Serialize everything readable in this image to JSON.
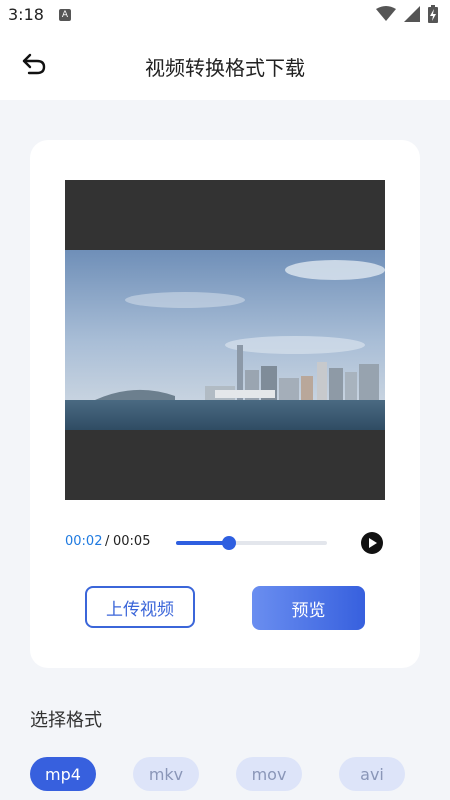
{
  "status_bar": {
    "time": "3:18",
    "notification_icon": "A",
    "icons": [
      "wifi-icon",
      "cellular-signal-icon",
      "battery-charging-icon"
    ]
  },
  "header": {
    "back_icon": "back-arrow-icon",
    "title": "视频转换格式下载"
  },
  "player": {
    "current_time": "00:02",
    "separator": "/",
    "total_time": "00:05",
    "progress": 0.35,
    "play_icon": "play-icon"
  },
  "actions": {
    "upload_label": "上传视频",
    "preview_label": "预览"
  },
  "formats": {
    "label": "选择格式",
    "options": [
      {
        "label": "mp4",
        "selected": true
      },
      {
        "label": "mkv",
        "selected": false
      },
      {
        "label": "mov",
        "selected": false
      },
      {
        "label": "avi",
        "selected": false
      }
    ]
  },
  "colors": {
    "accent": "#3760de",
    "time_current": "#1f7ae0",
    "format_unselected": "#dde4f9"
  }
}
